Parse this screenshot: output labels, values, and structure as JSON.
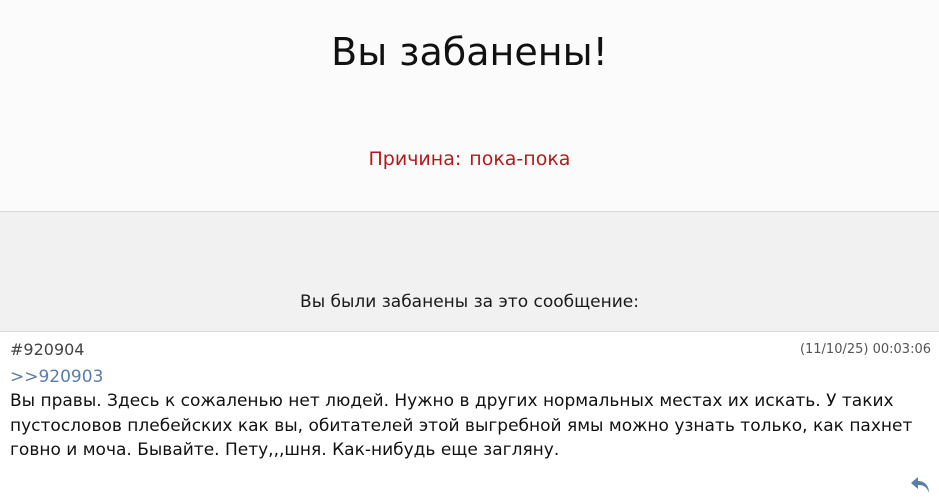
{
  "header": {
    "title": "Вы забанены!",
    "reason_label": "Причина:",
    "reason_value": "пока-пока",
    "reason_color": "#b31b1b"
  },
  "ban_notice": {
    "text": "Вы были забанены за это сообщение:"
  },
  "post": {
    "number": "#920904",
    "date": "(11/10/25) 00:03:06",
    "reply_link": ">>920903",
    "body": "Вы правы. Здесь к сожаленью нет людей. Нужно в других нормальных местах их искать. У таких пустословов плебейских как вы, обитателей этой выгребной ямы можно узнать только, как пахнет говно и моча. Бывайте. Пету,,,шня. Как-нибудь еще загляну.",
    "reply_icon": "reply-arrow-icon",
    "link_color": "#5a7ea8"
  }
}
